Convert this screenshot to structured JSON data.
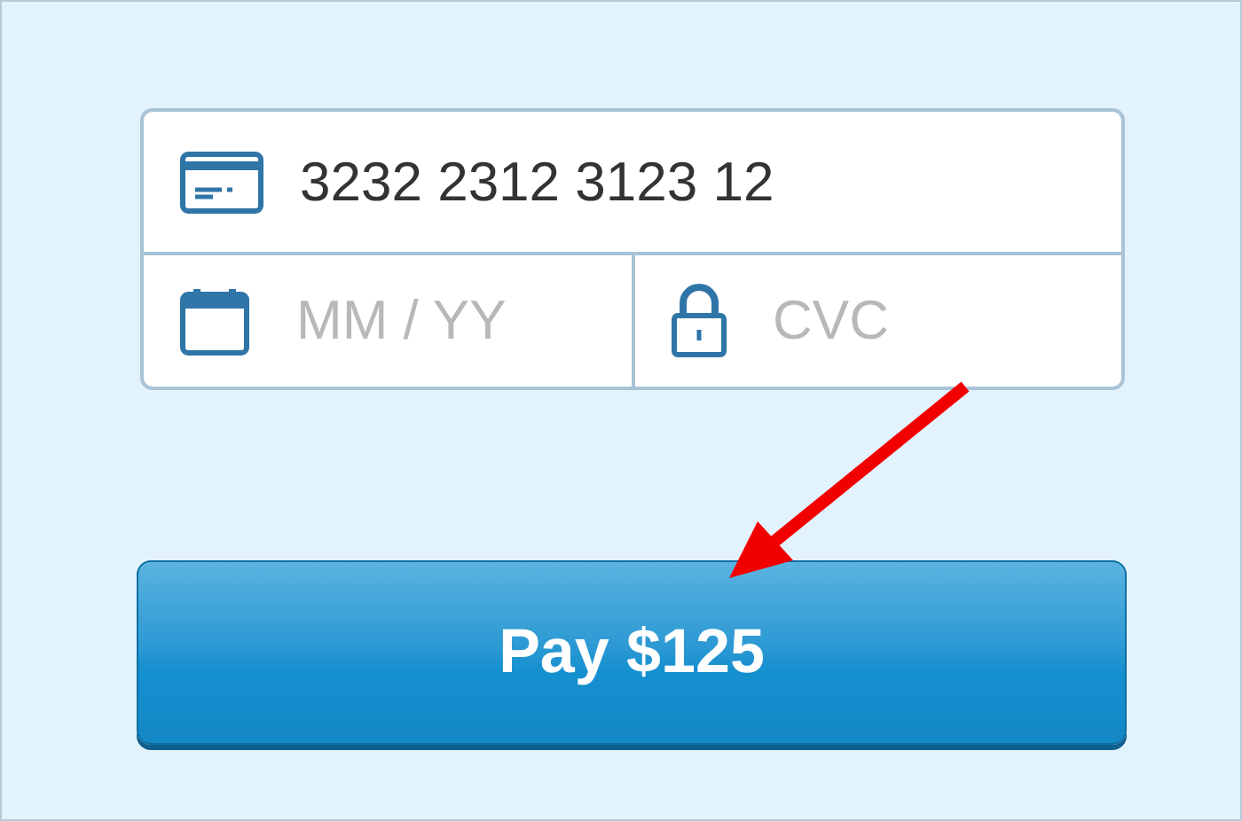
{
  "card_form": {
    "card_number": {
      "value": "3232 2312 3123 12"
    },
    "expiry": {
      "placeholder": "MM / YY"
    },
    "cvc": {
      "placeholder": "CVC"
    }
  },
  "pay_button": {
    "label": "Pay $125"
  }
}
